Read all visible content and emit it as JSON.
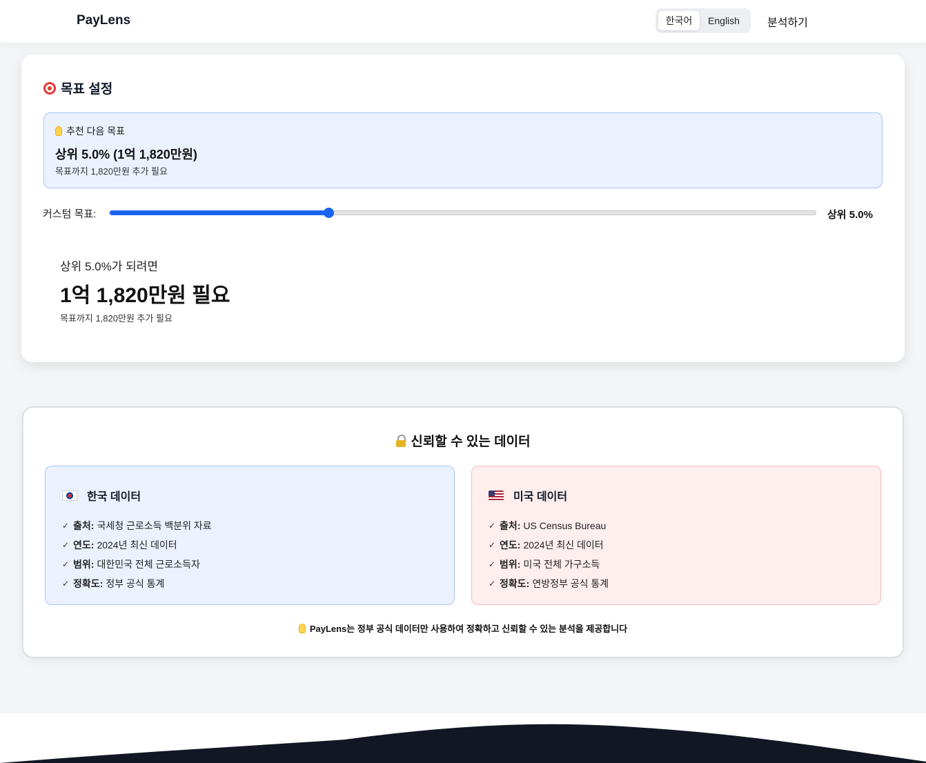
{
  "header": {
    "brand": "PayLens",
    "lang_ko": "한국어",
    "lang_en": "English",
    "analyze": "분석하기"
  },
  "goal": {
    "title": "목표 설정",
    "rec_label": "추천 다음 목표",
    "rec_value": "상위 5.0% (1억 1,820만원)",
    "rec_sub": "목표까지 1,820만원 추가 필요",
    "slider_label": "커스텀 목표:",
    "slider_value": "상위 5.0%",
    "slider_fraction": 0.31,
    "need_intro": "상위 5.0%가 되려면",
    "need_amount": "1억 1,820만원 필요",
    "need_sub": "목표까지 1,820만원 추가 필요"
  },
  "trust": {
    "title": "신뢰할 수 있는 데이터",
    "kr": {
      "title": "한국 데이터",
      "items": [
        {
          "label": "출처:",
          "value": "국세청 근로소득 백분위 자료"
        },
        {
          "label": "연도:",
          "value": "2024년 최신 데이터"
        },
        {
          "label": "범위:",
          "value": "대한민국 전체 근로소득자"
        },
        {
          "label": "정확도:",
          "value": "정부 공식 통계"
        }
      ]
    },
    "us": {
      "title": "미국 데이터",
      "items": [
        {
          "label": "출처:",
          "value": "US Census Bureau"
        },
        {
          "label": "연도:",
          "value": "2024년 최신 데이터"
        },
        {
          "label": "범위:",
          "value": "미국 전체 가구소득"
        },
        {
          "label": "정확도:",
          "value": "연방정부 공식 통계"
        }
      ]
    },
    "note": "PayLens는 정부 공식 데이터만 사용하여 정확하고 신뢰할 수 있는 분석을 제공합니다",
    "check_glyph": "✓"
  },
  "colors": {
    "accent": "#1a63f0",
    "footer_dark": "#121723"
  }
}
